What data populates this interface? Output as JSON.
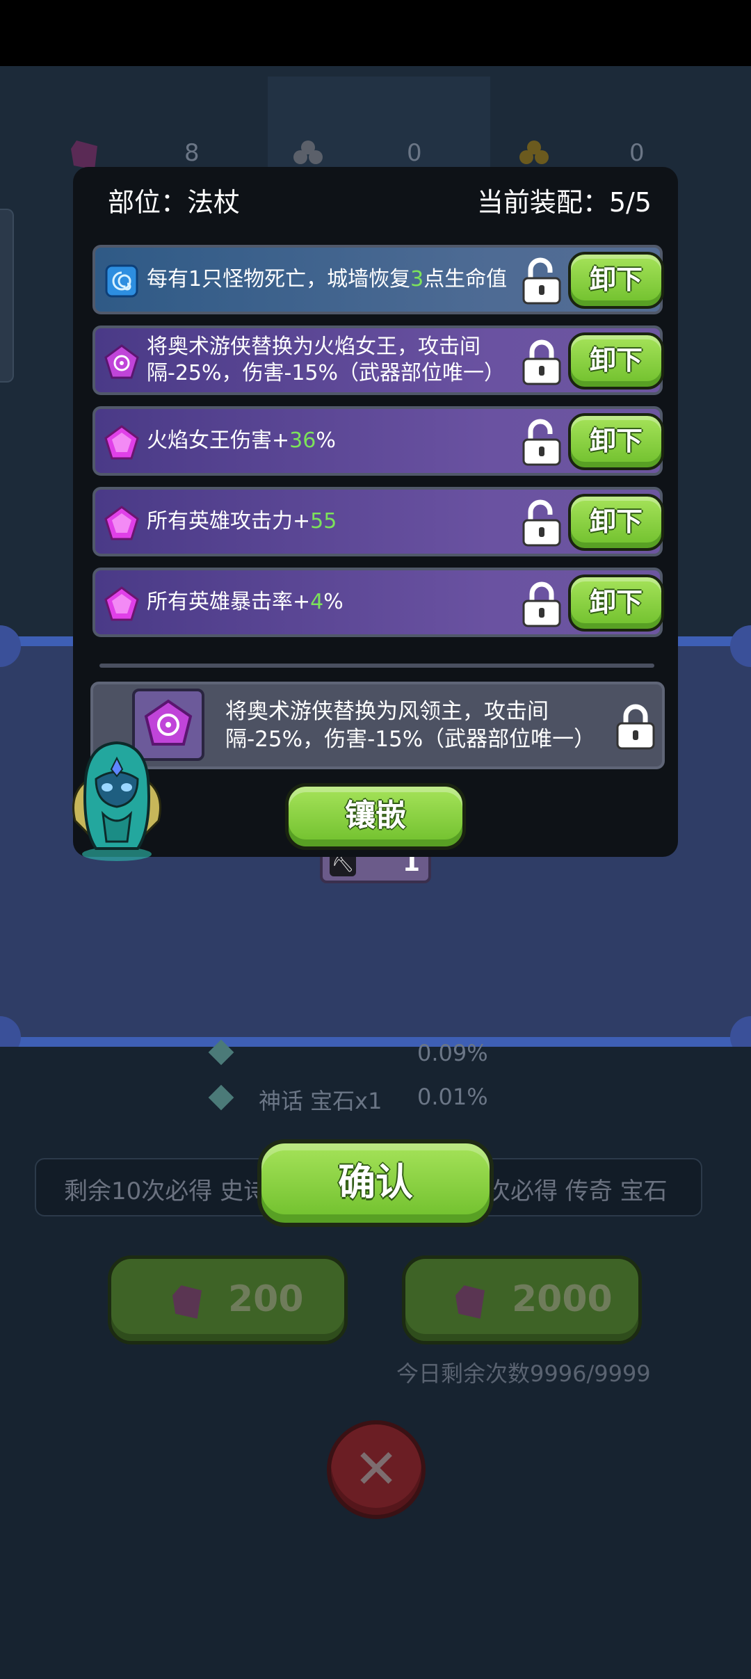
{
  "colors": {
    "panel_bg": "#0e1217",
    "button_green": "#8fd24a",
    "highlight_value": "#7ce35a",
    "slot_blue": "#3f6590",
    "slot_purple": "#5c479a"
  },
  "background": {
    "currency": [
      {
        "icon": "purple-gem-icon",
        "value": "8"
      },
      {
        "icon": "gray-clover-icon",
        "value": "0"
      },
      {
        "icon": "gold-clover-icon",
        "value": "0"
      }
    ],
    "reward_count": "1",
    "rates": [
      {
        "prefix": "",
        "value": "0.09%"
      },
      {
        "prefix": "神话 宝石x1",
        "value": "0.01%"
      }
    ],
    "guarantee_left": "剩余10次必得 史诗",
    "guarantee_right": "次必得 传奇 宝石",
    "draw_buttons": [
      {
        "icon": "purple-gem-icon",
        "cost": "200"
      },
      {
        "icon": "purple-gem-icon",
        "cost": "2000"
      }
    ],
    "remaining_today": "今日剩余次数9996/9999"
  },
  "confirm": {
    "label": "确认"
  },
  "panel": {
    "slot_label": "部位：法杖",
    "equipped_label": "当前装配：5/5",
    "slots": [
      {
        "icon": "blue-swirl-gem-icon",
        "text_before": "每有1只怪物死亡，城墙恢复",
        "value": "3",
        "text_after": "点生命值",
        "lock": "unlocked-padlock-icon",
        "button": "卸下"
      },
      {
        "icon": "purple-rune-gem-icon",
        "text_before": "将奥术游侠替换为火焰女王，攻击间隔-25%，伤害-15%（武器部位唯一）",
        "value": "",
        "text_after": "",
        "lock": "locked-padlock-icon",
        "button": "卸下"
      },
      {
        "icon": "pink-pentagon-gem-icon",
        "text_before": "火焰女王伤害+",
        "value": "36",
        "text_after": "%",
        "lock": "unlocked-padlock-icon",
        "button": "卸下"
      },
      {
        "icon": "pink-pentagon-gem-icon",
        "text_before": "所有英雄攻击力+",
        "value": "55",
        "text_after": "",
        "lock": "unlocked-padlock-icon",
        "button": "卸下"
      },
      {
        "icon": "pink-pentagon-gem-icon",
        "text_before": "所有英雄暴击率+",
        "value": "4",
        "text_after": "%",
        "lock": "locked-padlock-icon",
        "button": "卸下"
      }
    ],
    "candidate": {
      "icon": "purple-rune-gem-icon",
      "text": "将奥术游侠替换为风领主，攻击间隔-25%，伤害-15%（武器部位唯一）",
      "lock": "locked-padlock-icon"
    },
    "inlay_button": "镶嵌"
  }
}
